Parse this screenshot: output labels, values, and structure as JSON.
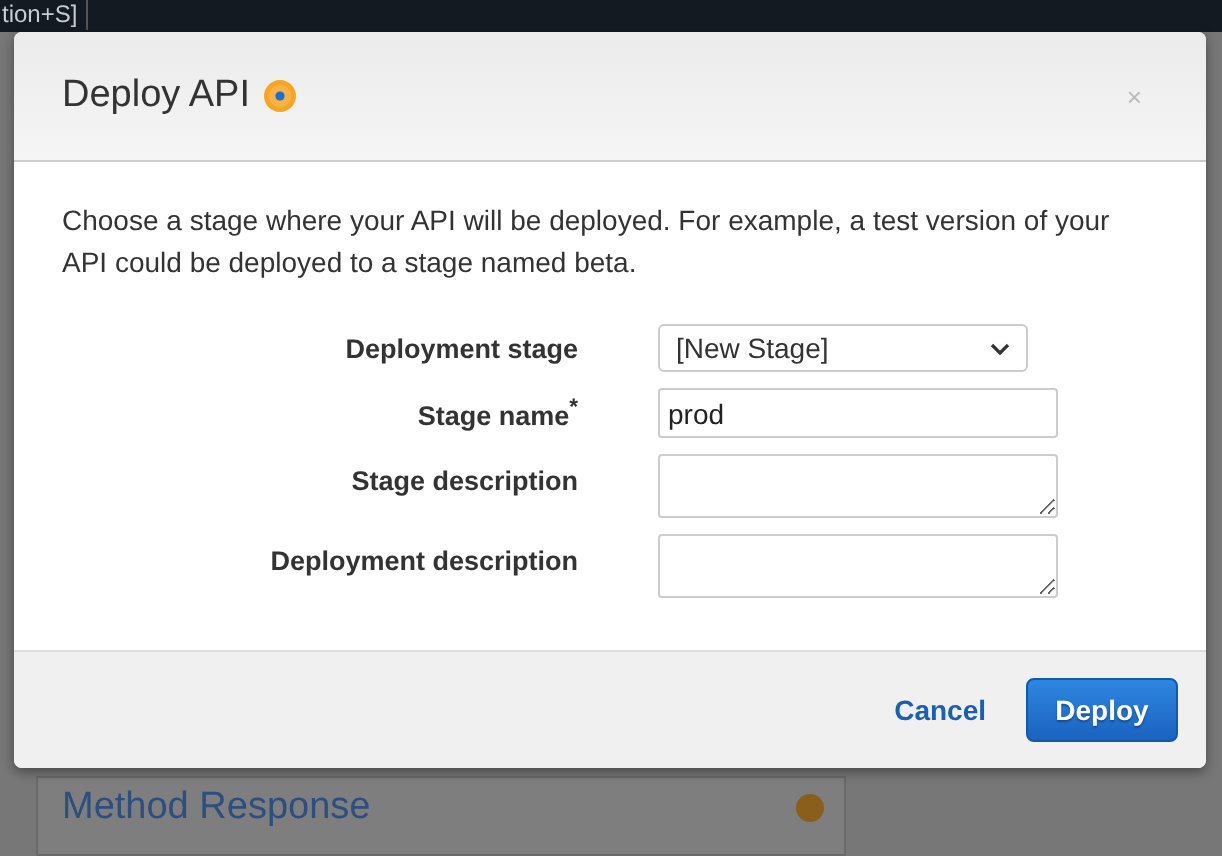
{
  "background": {
    "toolbar_text": "tion+S]",
    "panel_link": "Method Response"
  },
  "dialog": {
    "title": "Deploy API",
    "close": "×",
    "intro": "Choose a stage where your API will be deployed. For example, a test version of your API could be deployed to a stage named beta.",
    "fields": [
      {
        "label": "Deployment stage",
        "kind": "select",
        "value": "[New Stage]"
      },
      {
        "label": "Stage name$^{*}$",
        "kind": "text",
        "value": "prod"
      },
      {
        "label": "Stage description",
        "kind": "textarea"
      },
      {
        "label": "Deployment description",
        "kind": "textarea"
      }
    ],
    "buttons": [
      {
        "label": "Cancel",
        "kind": "link"
      },
      {
        "label": "Deploy",
        "kind": "primary"
      }
    ]
  }
}
